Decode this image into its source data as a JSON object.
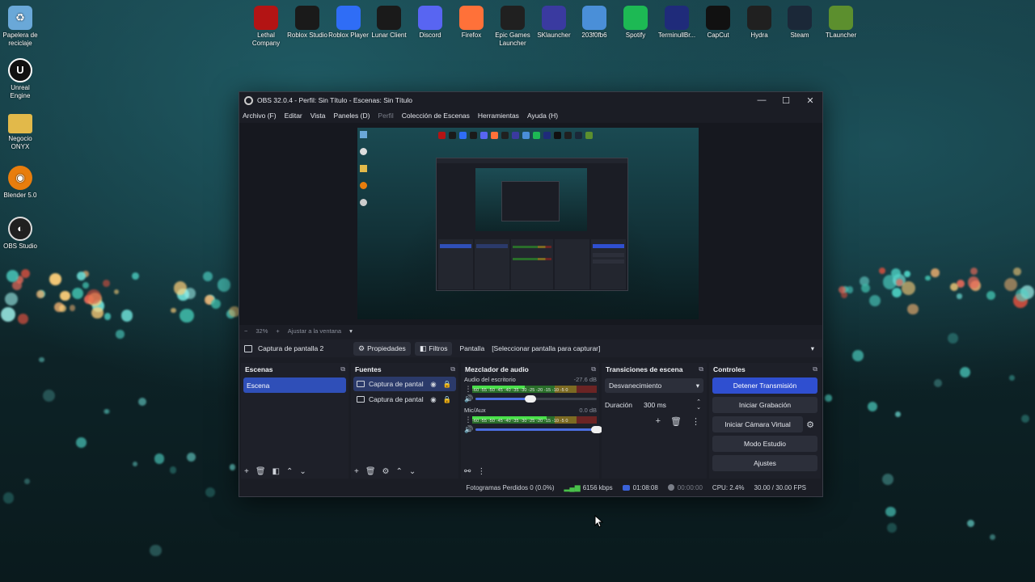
{
  "desktop": {
    "left_icons": [
      {
        "label": "Papelera de reciclaje",
        "icon": "recycle-bin-icon",
        "color": "#6aa8d8"
      },
      {
        "label": "Unreal Engine",
        "icon": "unreal-engine-icon",
        "color": "#111111"
      },
      {
        "label": "Negocio ONYX",
        "icon": "folder-icon",
        "color": "#e2b94a"
      },
      {
        "label": "Blender 5.0",
        "icon": "blender-icon",
        "color": "#e87d0d"
      },
      {
        "label": "OBS Studio",
        "icon": "obs-icon",
        "color": "#202020"
      }
    ],
    "top_icons": [
      {
        "label": "Lethal Company",
        "icon": "lethal-company-icon",
        "color": "#b31414"
      },
      {
        "label": "Roblox Studio",
        "icon": "roblox-studio-icon",
        "color": "#1a1a1a"
      },
      {
        "label": "Roblox Player",
        "icon": "roblox-player-icon",
        "color": "#2f6df6"
      },
      {
        "label": "Lunar Client",
        "icon": "lunar-client-icon",
        "color": "#1a1a1a"
      },
      {
        "label": "Discord",
        "icon": "discord-icon",
        "color": "#5865f2"
      },
      {
        "label": "Firefox",
        "icon": "firefox-icon",
        "color": "#ff7139"
      },
      {
        "label": "Epic Games Launcher",
        "icon": "epic-games-icon",
        "color": "#202020"
      },
      {
        "label": "SKlauncher",
        "icon": "sklauncher-icon",
        "color": "#3a3aa0"
      },
      {
        "label": "203f0fb6",
        "icon": "file-icon",
        "color": "#4a8fd8"
      },
      {
        "label": "Spotify",
        "icon": "spotify-icon",
        "color": "#1db954"
      },
      {
        "label": "TerminullBr...",
        "icon": "terminull-icon",
        "color": "#1f2b7a"
      },
      {
        "label": "CapCut",
        "icon": "capcut-icon",
        "color": "#111111"
      },
      {
        "label": "Hydra",
        "icon": "hydra-icon",
        "color": "#202020"
      },
      {
        "label": "Steam",
        "icon": "steam-icon",
        "color": "#1b2838"
      },
      {
        "label": "TLauncher",
        "icon": "tlauncher-icon",
        "color": "#5c8f2e"
      }
    ]
  },
  "obs": {
    "title": "OBS 32.0.4 - Perfil: Sin Título - Escenas: Sin Título",
    "menu": [
      "Archivo (F)",
      "Editar",
      "Vista",
      "Paneles (D)",
      "Perfil",
      "Colección de Escenas",
      "Herramientas",
      "Ayuda (H)"
    ],
    "zoom": {
      "minus": "−",
      "value": "32%",
      "plus": "+",
      "fit": "Ajustar a la ventana"
    },
    "source_bar": {
      "source_name": "Captura de pantalla 2",
      "properties": "Propiedades",
      "filters": "Filtros",
      "screen_label": "Pantalla",
      "screen_value": "[Seleccionar pantalla para capturar]"
    },
    "scenes": {
      "title": "Escenas",
      "items": [
        "Escena"
      ]
    },
    "sources": {
      "title": "Fuentes",
      "items": [
        "Captura de pantal",
        "Captura de pantal"
      ]
    },
    "mixer": {
      "title": "Mezclador de audio",
      "scale": "-60 -55 -50 -45 -40 -35 -30 -25 -20 -15 -10 -5 0",
      "channels": [
        {
          "name": "Audio del escritorio",
          "db": "-27.6 dB",
          "level": 0.42,
          "volume": 0.45
        },
        {
          "name": "Mic/Aux",
          "db": "0.0 dB",
          "level": 0.6,
          "volume": 1.0
        }
      ]
    },
    "transitions": {
      "title": "Transiciones de escena",
      "selected": "Desvanecimiento",
      "duration_label": "Duración",
      "duration_value": "300 ms"
    },
    "controls": {
      "title": "Controles",
      "stop_stream": "Detener Transmisión",
      "start_recording": "Iniciar Grabación",
      "virtual_cam": "Iniciar Cámara Virtual",
      "studio_mode": "Modo Estudio",
      "settings": "Ajustes"
    },
    "status": {
      "dropped": "Fotogramas Perdidos 0 (0.0%)",
      "bitrate": "6156 kbps",
      "live_time": "01:08:08",
      "rec_time": "00:00:00",
      "cpu": "CPU: 2.4%",
      "fps": "30.00 / 30.00 FPS"
    },
    "colors": {
      "accent": "#2f4fd0",
      "bg": "#1b1d25",
      "panel": "#1e2029"
    }
  }
}
